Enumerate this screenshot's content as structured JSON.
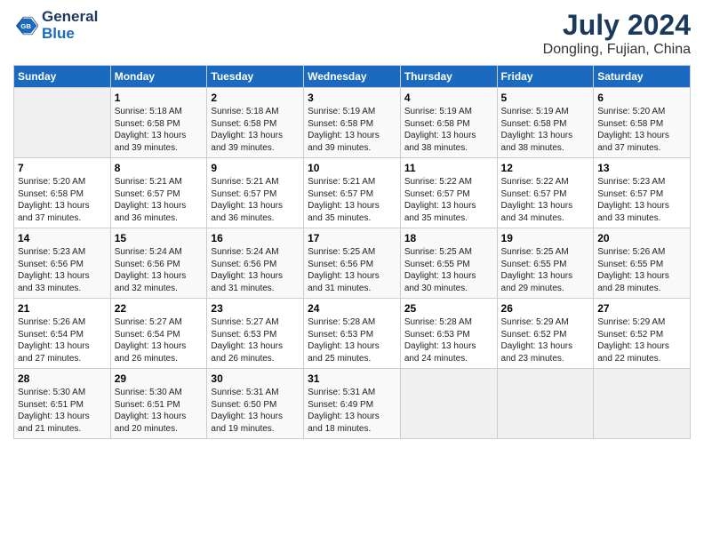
{
  "logo": {
    "line1": "General",
    "line2": "Blue"
  },
  "title": "July 2024",
  "subtitle": "Dongling, Fujian, China",
  "weekdays": [
    "Sunday",
    "Monday",
    "Tuesday",
    "Wednesday",
    "Thursday",
    "Friday",
    "Saturday"
  ],
  "weeks": [
    [
      {
        "day": "",
        "info": ""
      },
      {
        "day": "1",
        "info": "Sunrise: 5:18 AM\nSunset: 6:58 PM\nDaylight: 13 hours\nand 39 minutes."
      },
      {
        "day": "2",
        "info": "Sunrise: 5:18 AM\nSunset: 6:58 PM\nDaylight: 13 hours\nand 39 minutes."
      },
      {
        "day": "3",
        "info": "Sunrise: 5:19 AM\nSunset: 6:58 PM\nDaylight: 13 hours\nand 39 minutes."
      },
      {
        "day": "4",
        "info": "Sunrise: 5:19 AM\nSunset: 6:58 PM\nDaylight: 13 hours\nand 38 minutes."
      },
      {
        "day": "5",
        "info": "Sunrise: 5:19 AM\nSunset: 6:58 PM\nDaylight: 13 hours\nand 38 minutes."
      },
      {
        "day": "6",
        "info": "Sunrise: 5:20 AM\nSunset: 6:58 PM\nDaylight: 13 hours\nand 37 minutes."
      }
    ],
    [
      {
        "day": "7",
        "info": "Sunrise: 5:20 AM\nSunset: 6:58 PM\nDaylight: 13 hours\nand 37 minutes."
      },
      {
        "day": "8",
        "info": "Sunrise: 5:21 AM\nSunset: 6:57 PM\nDaylight: 13 hours\nand 36 minutes."
      },
      {
        "day": "9",
        "info": "Sunrise: 5:21 AM\nSunset: 6:57 PM\nDaylight: 13 hours\nand 36 minutes."
      },
      {
        "day": "10",
        "info": "Sunrise: 5:21 AM\nSunset: 6:57 PM\nDaylight: 13 hours\nand 35 minutes."
      },
      {
        "day": "11",
        "info": "Sunrise: 5:22 AM\nSunset: 6:57 PM\nDaylight: 13 hours\nand 35 minutes."
      },
      {
        "day": "12",
        "info": "Sunrise: 5:22 AM\nSunset: 6:57 PM\nDaylight: 13 hours\nand 34 minutes."
      },
      {
        "day": "13",
        "info": "Sunrise: 5:23 AM\nSunset: 6:57 PM\nDaylight: 13 hours\nand 33 minutes."
      }
    ],
    [
      {
        "day": "14",
        "info": "Sunrise: 5:23 AM\nSunset: 6:56 PM\nDaylight: 13 hours\nand 33 minutes."
      },
      {
        "day": "15",
        "info": "Sunrise: 5:24 AM\nSunset: 6:56 PM\nDaylight: 13 hours\nand 32 minutes."
      },
      {
        "day": "16",
        "info": "Sunrise: 5:24 AM\nSunset: 6:56 PM\nDaylight: 13 hours\nand 31 minutes."
      },
      {
        "day": "17",
        "info": "Sunrise: 5:25 AM\nSunset: 6:56 PM\nDaylight: 13 hours\nand 31 minutes."
      },
      {
        "day": "18",
        "info": "Sunrise: 5:25 AM\nSunset: 6:55 PM\nDaylight: 13 hours\nand 30 minutes."
      },
      {
        "day": "19",
        "info": "Sunrise: 5:25 AM\nSunset: 6:55 PM\nDaylight: 13 hours\nand 29 minutes."
      },
      {
        "day": "20",
        "info": "Sunrise: 5:26 AM\nSunset: 6:55 PM\nDaylight: 13 hours\nand 28 minutes."
      }
    ],
    [
      {
        "day": "21",
        "info": "Sunrise: 5:26 AM\nSunset: 6:54 PM\nDaylight: 13 hours\nand 27 minutes."
      },
      {
        "day": "22",
        "info": "Sunrise: 5:27 AM\nSunset: 6:54 PM\nDaylight: 13 hours\nand 26 minutes."
      },
      {
        "day": "23",
        "info": "Sunrise: 5:27 AM\nSunset: 6:53 PM\nDaylight: 13 hours\nand 26 minutes."
      },
      {
        "day": "24",
        "info": "Sunrise: 5:28 AM\nSunset: 6:53 PM\nDaylight: 13 hours\nand 25 minutes."
      },
      {
        "day": "25",
        "info": "Sunrise: 5:28 AM\nSunset: 6:53 PM\nDaylight: 13 hours\nand 24 minutes."
      },
      {
        "day": "26",
        "info": "Sunrise: 5:29 AM\nSunset: 6:52 PM\nDaylight: 13 hours\nand 23 minutes."
      },
      {
        "day": "27",
        "info": "Sunrise: 5:29 AM\nSunset: 6:52 PM\nDaylight: 13 hours\nand 22 minutes."
      }
    ],
    [
      {
        "day": "28",
        "info": "Sunrise: 5:30 AM\nSunset: 6:51 PM\nDaylight: 13 hours\nand 21 minutes."
      },
      {
        "day": "29",
        "info": "Sunrise: 5:30 AM\nSunset: 6:51 PM\nDaylight: 13 hours\nand 20 minutes."
      },
      {
        "day": "30",
        "info": "Sunrise: 5:31 AM\nSunset: 6:50 PM\nDaylight: 13 hours\nand 19 minutes."
      },
      {
        "day": "31",
        "info": "Sunrise: 5:31 AM\nSunset: 6:49 PM\nDaylight: 13 hours\nand 18 minutes."
      },
      {
        "day": "",
        "info": ""
      },
      {
        "day": "",
        "info": ""
      },
      {
        "day": "",
        "info": ""
      }
    ]
  ]
}
